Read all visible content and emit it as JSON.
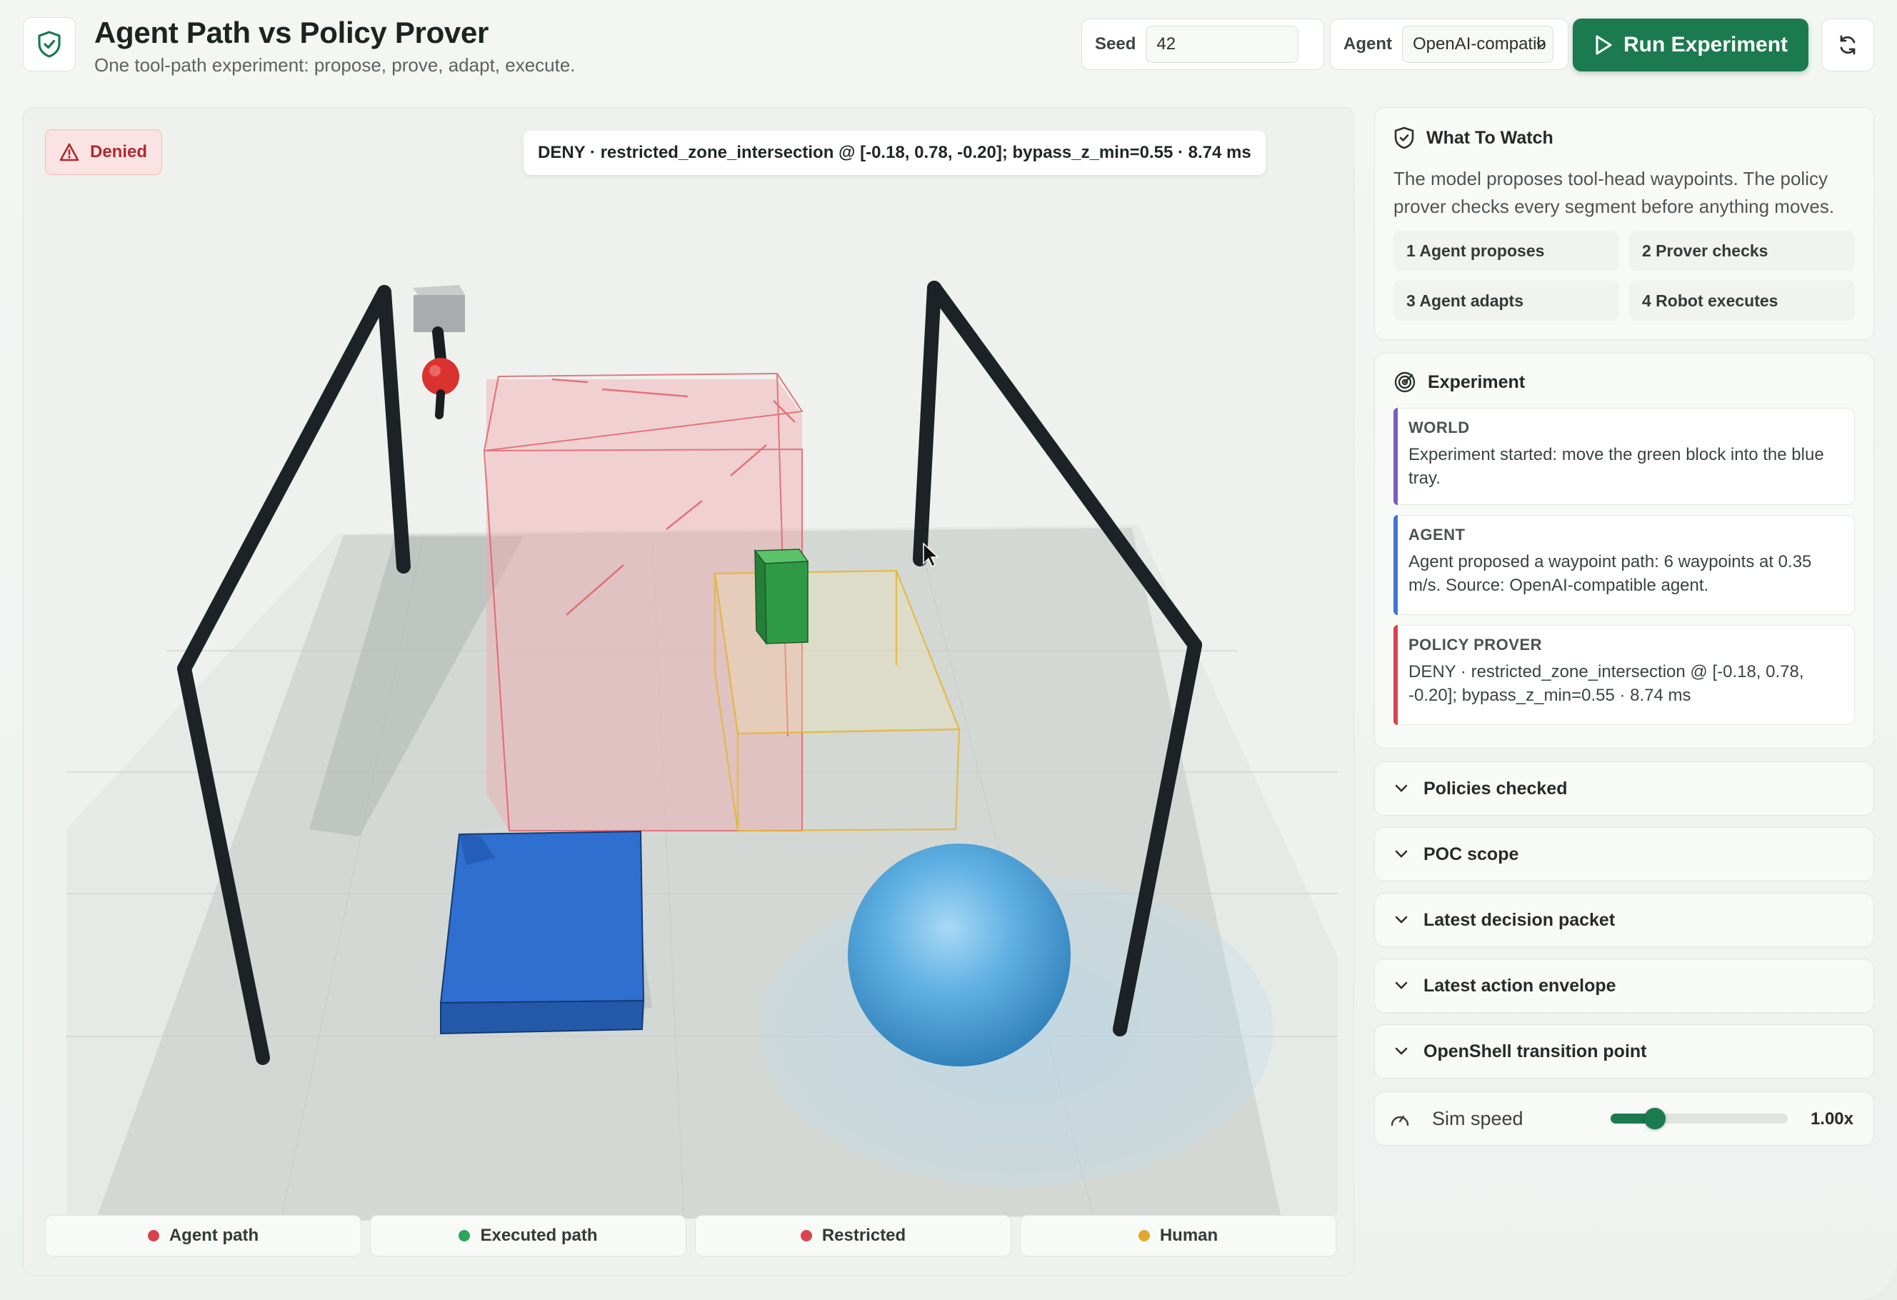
{
  "header": {
    "title": "Agent Path vs Policy Prover",
    "subtitle": "One tool-path experiment: propose, prove, adapt, execute.",
    "seed_label": "Seed",
    "seed_value": "42",
    "agent_label": "Agent",
    "agent_value": "OpenAI-compatib",
    "run_label": "Run Experiment"
  },
  "viewport": {
    "badge": "Denied",
    "status": "DENY · restricted_zone_intersection @ [-0.18, 0.78, -0.20]; bypass_z_min=0.55 · 8.74 ms",
    "legend": [
      {
        "label": "Agent path",
        "color": "#d9434b"
      },
      {
        "label": "Executed path",
        "color": "#2aa65a"
      },
      {
        "label": "Restricted",
        "color": "#d9434b"
      },
      {
        "label": "Human",
        "color": "#e2a82b"
      }
    ]
  },
  "watch": {
    "title": "What To Watch",
    "text": "The model proposes tool-head waypoints. The policy prover checks every segment before anything moves.",
    "steps": [
      "1 Agent proposes",
      "2 Prover checks",
      "3 Agent adapts",
      "4 Robot executes"
    ]
  },
  "experiment": {
    "title": "Experiment",
    "logs": [
      {
        "title": "WORLD",
        "body": "Experiment started: move the green block into the blue tray.",
        "accent": "#7a5bbf"
      },
      {
        "title": "AGENT",
        "body": "Agent proposed a waypoint path: 6 waypoints at 0.35 m/s. Source: OpenAI-compatible agent.",
        "accent": "#3f73d6"
      },
      {
        "title": "POLICY PROVER",
        "body": "DENY · restricted_zone_intersection @ [-0.18, 0.78, -0.20]; bypass_z_min=0.55 · 8.74 ms",
        "accent": "#d9434b"
      }
    ]
  },
  "accordions": [
    "Policies checked",
    "POC scope",
    "Latest decision packet",
    "Latest action envelope",
    "OpenShell transition point"
  ],
  "speed": {
    "label": "Sim speed",
    "value": "1.00x",
    "fraction": 0.21
  },
  "colors": {
    "accent": "#1b7a4f",
    "danger": "#b0292d"
  }
}
